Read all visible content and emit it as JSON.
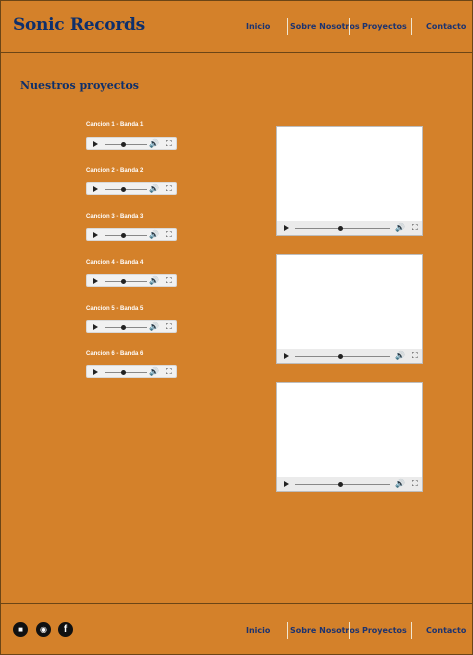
{
  "header": {
    "brand": "Sonic Records",
    "nav": [
      "Inicio",
      "Sobre Nosotros",
      "Proyectos",
      "Contacto"
    ]
  },
  "main": {
    "title": "Nuestros proyectos",
    "tracks": [
      "Cancion 1 - Banda 1",
      "Cancion 2 - Banda 2",
      "Cancion 3 - Banda 3",
      "Cancion 4 - Banda 4",
      "Cancion 5 - Banda 5",
      "Cancion 6 - Banda 6"
    ],
    "videos_count_label": ""
  },
  "footer": {
    "social": [
      {
        "icon": "video-camera-icon",
        "glyph": "■"
      },
      {
        "icon": "podcast-icon",
        "glyph": "◉"
      },
      {
        "icon": "facebook-icon",
        "glyph": "f"
      }
    ],
    "nav": [
      "Inicio",
      "Sobre Nosotros",
      "Proyectos",
      "Contacto"
    ]
  },
  "media_controls": {
    "play": "▶",
    "volume": "🔊",
    "fullscreen": "⛶"
  }
}
